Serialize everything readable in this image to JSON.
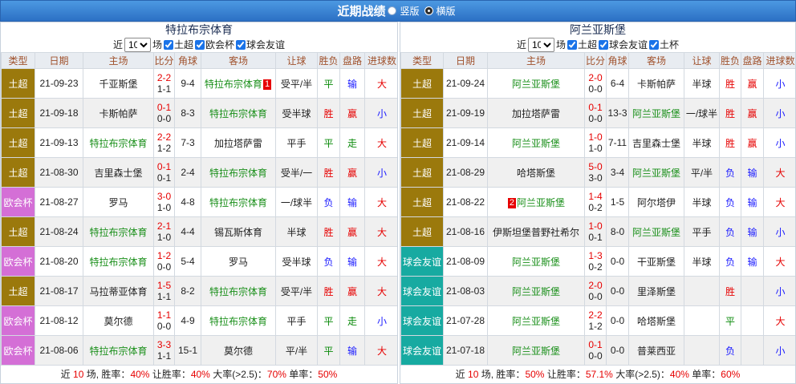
{
  "header": {
    "title": "近期战绩",
    "layout_options": [
      {
        "label": "竖版",
        "checked": false
      },
      {
        "label": "横版",
        "checked": true
      }
    ]
  },
  "columns": [
    "类型",
    "日期",
    "主场",
    "比分",
    "角球",
    "客场",
    "让球",
    "胜负",
    "盘路",
    "进球数"
  ],
  "colors": {
    "highlight_team": "#1a8f1a"
  },
  "type_colors": {
    "土超": "#9b790c",
    "欧会杯": "#d46fd6",
    "球会友谊": "#17aaa1"
  },
  "result_colors": {
    "胜": "#e60000",
    "赢": "#e60000",
    "大": "#e60000",
    "平": "#0a8a0a",
    "走": "#0a8a0a",
    "负": "#1a1aff",
    "输": "#1a1aff",
    "小": "#1a1aff"
  },
  "panels": [
    {
      "team": "特拉布宗体育",
      "controls": {
        "prefix": "近",
        "count": "10",
        "suffix": "场",
        "filters": [
          {
            "label": "土超",
            "checked": true
          },
          {
            "label": "欧会杯",
            "checked": true
          },
          {
            "label": "球会友谊",
            "checked": true
          }
        ]
      },
      "rows": [
        {
          "type": "土超",
          "date": "21-09-23",
          "home": "千亚斯堡",
          "ft": "2-2",
          "ht": "1-1",
          "corner": "9-4",
          "away": "特拉布宗体育",
          "away_red_card": "1",
          "handicap": "受平/半",
          "result": "平",
          "pan": "输",
          "goals": "大"
        },
        {
          "type": "土超",
          "date": "21-09-18",
          "home": "卡斯帕萨",
          "ft": "0-1",
          "ht": "0-0",
          "corner": "8-3",
          "away": "特拉布宗体育",
          "handicap": "受半球",
          "result": "胜",
          "pan": "赢",
          "goals": "小"
        },
        {
          "type": "土超",
          "date": "21-09-13",
          "home": "特拉布宗体育",
          "ft": "2-2",
          "ht": "1-2",
          "corner": "7-3",
          "away": "加拉塔萨雷",
          "handicap": "平手",
          "result": "平",
          "pan": "走",
          "goals": "大"
        },
        {
          "type": "土超",
          "date": "21-08-30",
          "home": "吉里森士堡",
          "ft": "0-1",
          "ht": "0-1",
          "corner": "2-4",
          "away": "特拉布宗体育",
          "handicap": "受半/一",
          "result": "胜",
          "pan": "赢",
          "goals": "小"
        },
        {
          "type": "欧会杯",
          "date": "21-08-27",
          "home": "罗马",
          "ft": "3-0",
          "ht": "1-0",
          "corner": "4-8",
          "away": "特拉布宗体育",
          "handicap": "一/球半",
          "result": "负",
          "pan": "输",
          "goals": "大"
        },
        {
          "type": "土超",
          "date": "21-08-24",
          "home": "特拉布宗体育",
          "ft": "2-1",
          "ht": "1-0",
          "corner": "4-4",
          "away": "锡瓦斯体育",
          "handicap": "半球",
          "result": "胜",
          "pan": "赢",
          "goals": "大"
        },
        {
          "type": "欧会杯",
          "date": "21-08-20",
          "home": "特拉布宗体育",
          "ft": "1-2",
          "ht": "0-0",
          "corner": "5-4",
          "away": "罗马",
          "handicap": "受半球",
          "result": "负",
          "pan": "输",
          "goals": "大"
        },
        {
          "type": "土超",
          "date": "21-08-17",
          "home": "马拉蒂亚体育",
          "ft": "1-5",
          "ht": "1-1",
          "corner": "8-2",
          "away": "特拉布宗体育",
          "handicap": "受平/半",
          "result": "胜",
          "pan": "赢",
          "goals": "大"
        },
        {
          "type": "欧会杯",
          "date": "21-08-12",
          "home": "莫尔德",
          "ft": "1-1",
          "ht": "0-0",
          "corner": "4-9",
          "away": "特拉布宗体育",
          "handicap": "平手",
          "result": "平",
          "pan": "走",
          "goals": "小"
        },
        {
          "type": "欧会杯",
          "date": "21-08-06",
          "home": "特拉布宗体育",
          "ft": "3-3",
          "ht": "1-1",
          "corner": "15-1",
          "away": "莫尔德",
          "handicap": "平/半",
          "result": "平",
          "pan": "输",
          "goals": "大"
        }
      ],
      "footer": {
        "label_near": "近",
        "count": "10",
        "label_games": "场,",
        "stats": [
          {
            "label": "胜率：",
            "value": "40%"
          },
          {
            "label": "让胜率：",
            "value": "40%"
          },
          {
            "label": "大率(>2.5)：",
            "value": "70%"
          },
          {
            "label": "单率：",
            "value": "50%"
          }
        ]
      }
    },
    {
      "team": "阿兰亚斯堡",
      "controls": {
        "prefix": "近",
        "count": "10",
        "suffix": "场",
        "filters": [
          {
            "label": "土超",
            "checked": true
          },
          {
            "label": "球会友谊",
            "checked": true
          },
          {
            "label": "土杯",
            "checked": true
          }
        ]
      },
      "rows": [
        {
          "type": "土超",
          "date": "21-09-24",
          "home": "阿兰亚斯堡",
          "ft": "2-0",
          "ht": "0-0",
          "corner": "6-4",
          "away": "卡斯帕萨",
          "handicap": "半球",
          "result": "胜",
          "pan": "赢",
          "goals": "小"
        },
        {
          "type": "土超",
          "date": "21-09-19",
          "home": "加拉塔萨雷",
          "ft": "0-1",
          "ht": "0-0",
          "corner": "13-3",
          "away": "阿兰亚斯堡",
          "handicap": "一/球半",
          "result": "胜",
          "pan": "赢",
          "goals": "小"
        },
        {
          "type": "土超",
          "date": "21-09-14",
          "home": "阿兰亚斯堡",
          "ft": "1-0",
          "ht": "1-0",
          "corner": "7-11",
          "away": "吉里森士堡",
          "handicap": "半球",
          "result": "胜",
          "pan": "赢",
          "goals": "小"
        },
        {
          "type": "土超",
          "date": "21-08-29",
          "home": "哈塔斯堡",
          "ft": "5-0",
          "ht": "3-0",
          "corner": "3-4",
          "away": "阿兰亚斯堡",
          "handicap": "平/半",
          "result": "负",
          "pan": "输",
          "goals": "大"
        },
        {
          "type": "土超",
          "date": "21-08-22",
          "home": "阿兰亚斯堡",
          "home_red_card": "2",
          "ft": "1-4",
          "ht": "0-2",
          "corner": "1-5",
          "away": "阿尔塔伊",
          "handicap": "半球",
          "result": "负",
          "pan": "输",
          "goals": "大"
        },
        {
          "type": "土超",
          "date": "21-08-16",
          "home": "伊斯坦堡普野社希尔",
          "ft": "1-0",
          "ht": "0-1",
          "corner": "8-0",
          "away": "阿兰亚斯堡",
          "handicap": "平手",
          "result": "负",
          "pan": "输",
          "goals": "小"
        },
        {
          "type": "球会友谊",
          "date": "21-08-09",
          "home": "阿兰亚斯堡",
          "ft": "1-3",
          "ht": "0-2",
          "corner": "0-0",
          "away": "干亚斯堡",
          "handicap": "半球",
          "result": "负",
          "pan": "输",
          "goals": "大"
        },
        {
          "type": "球会友谊",
          "date": "21-08-03",
          "home": "阿兰亚斯堡",
          "ft": "2-0",
          "ht": "0-0",
          "corner": "0-0",
          "away": "里泽斯堡",
          "handicap": "",
          "result": "胜",
          "pan": "",
          "goals": "小"
        },
        {
          "type": "球会友谊",
          "date": "21-07-28",
          "home": "阿兰亚斯堡",
          "ft": "2-2",
          "ht": "1-2",
          "corner": "0-0",
          "away": "哈塔斯堡",
          "handicap": "",
          "result": "平",
          "pan": "",
          "goals": "大"
        },
        {
          "type": "球会友谊",
          "date": "21-07-18",
          "home": "阿兰亚斯堡",
          "ft": "0-1",
          "ht": "0-0",
          "corner": "0-0",
          "away": "普莱西亚",
          "handicap": "",
          "result": "负",
          "pan": "",
          "goals": "小"
        }
      ],
      "footer": {
        "label_near": "近",
        "count": "10",
        "label_games": "场,",
        "stats": [
          {
            "label": "胜率：",
            "value": "50%"
          },
          {
            "label": "让胜率：",
            "value": "57.1%"
          },
          {
            "label": "大率(>2.5)：",
            "value": "40%"
          },
          {
            "label": "单率：",
            "value": "60%"
          }
        ]
      }
    }
  ]
}
